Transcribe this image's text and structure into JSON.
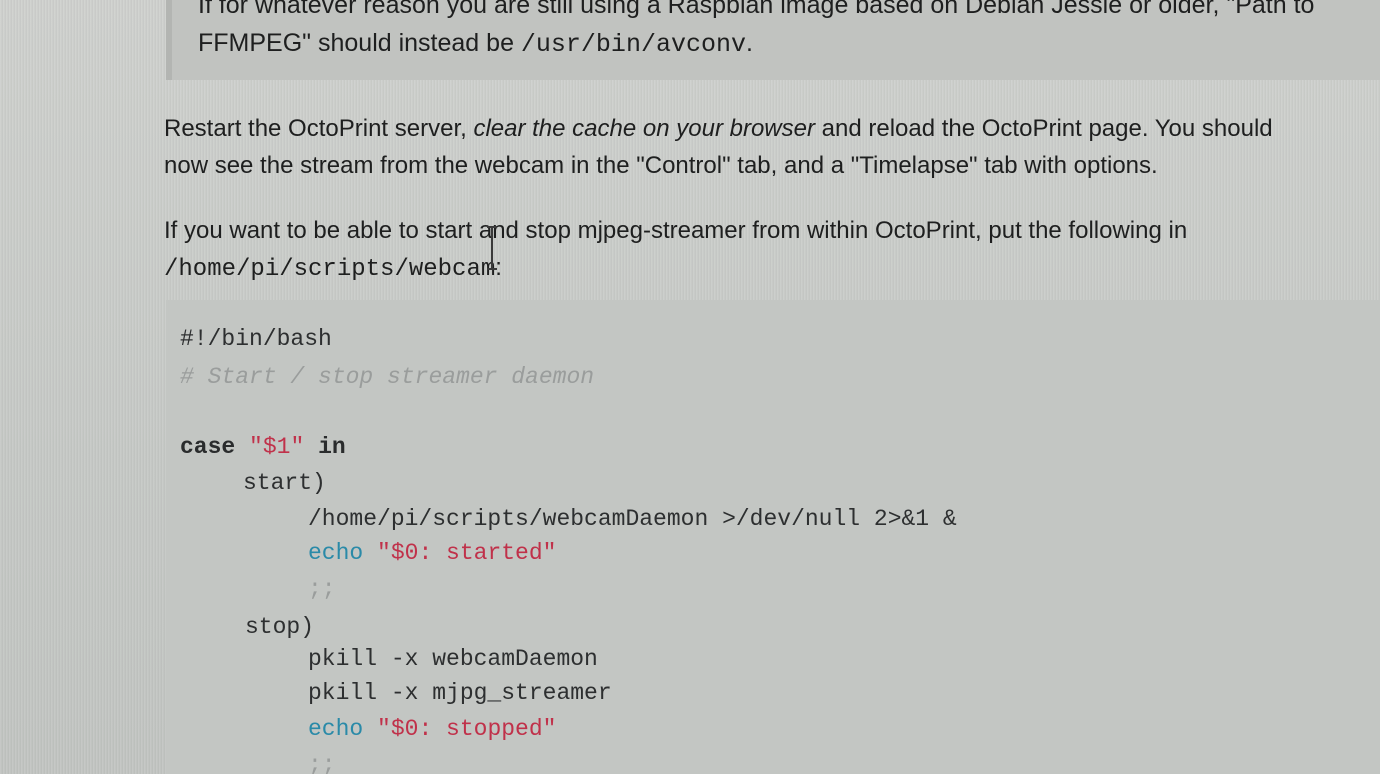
{
  "note": {
    "line1_text": "If for whatever reason you are still using a Raspbian image based on Debian Jessie or older, \"Path to",
    "line2_prefix": "FFMPEG\" should instead be ",
    "line2_code": "/usr/bin/avconv",
    "line2_suffix": "."
  },
  "para1": {
    "part1": "Restart the OctoPrint server, ",
    "emphasis": "clear the cache on your browser",
    "part2": " and reload the OctoPrint page. You should",
    "line2": "now see the stream from the webcam in the \"Control\" tab, and a \"Timelapse\" tab with options."
  },
  "para2": {
    "line1": "If you want to be able to start and stop mjpeg-streamer from within OctoPrint, put the following in",
    "path": "/home/pi/scripts/webcam",
    "suffix": ":"
  },
  "code": {
    "shebang": "#!/bin/bash",
    "comment": "# Start / stop streamer daemon",
    "case_kw": "case",
    "case_arg": "\"$1\"",
    "in_kw": "in",
    "start_label": "start)",
    "start_cmd": "/home/pi/scripts/webcamDaemon >/dev/null 2>&1 &",
    "echo_kw": "echo",
    "started_str": "\"$0: started\"",
    "terminator": ";;",
    "stop_label": "stop)",
    "pkill1": "pkill -x webcamDaemon",
    "pkill2": "pkill -x mjpg_streamer",
    "stopped_str": "\"$0: stopped\""
  }
}
